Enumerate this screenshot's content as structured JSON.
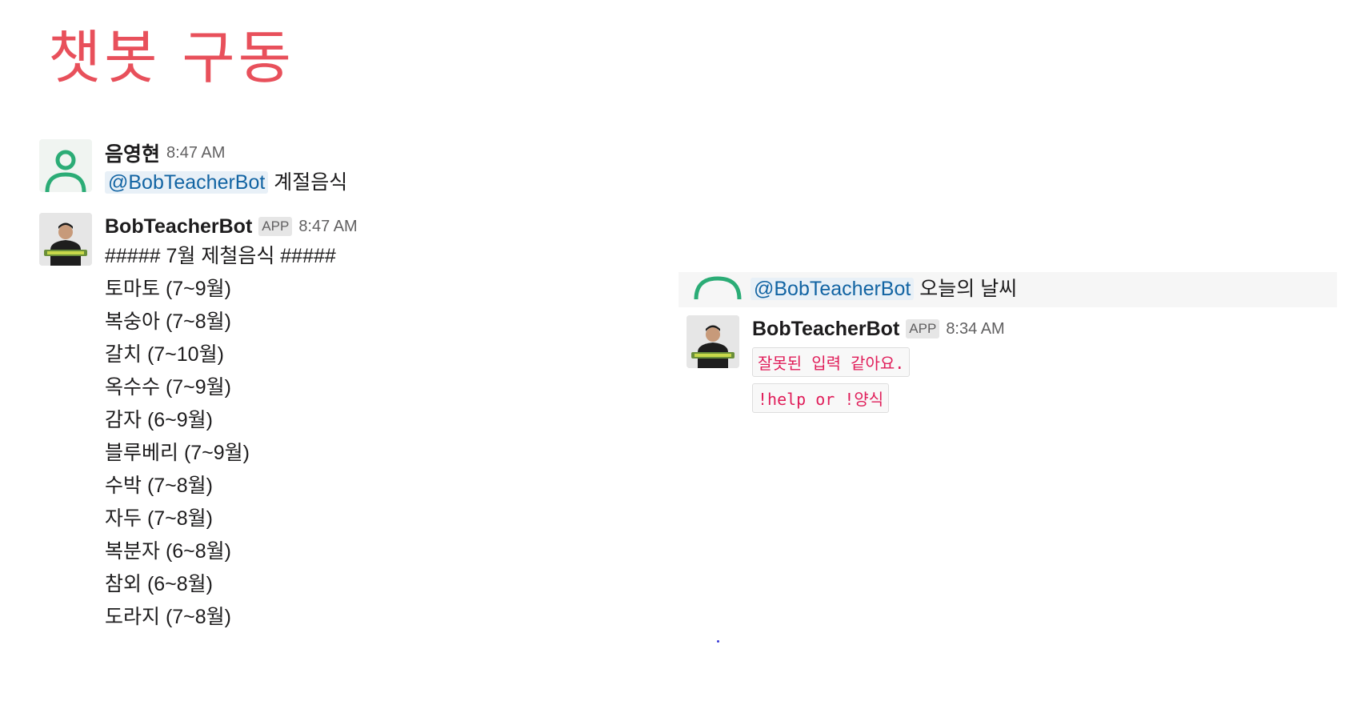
{
  "slide": {
    "title": "챗봇 구동"
  },
  "left_thread": {
    "user_message": {
      "sender": "음영현",
      "time": "8:47 AM",
      "mention": "@BobTeacherBot",
      "text": "계절음식",
      "avatar_icon": "person-outline-icon"
    },
    "bot_message": {
      "sender": "BobTeacherBot",
      "badge": "APP",
      "time": "8:47 AM",
      "avatar_icon": "bot-chef-photo",
      "lines": [
        "##### 7월 제철음식 #####",
        "토마토 (7~9월)",
        "복숭아 (7~8월)",
        "갈치 (7~10월)",
        "옥수수 (7~9월)",
        "감자 (6~9월)",
        "블루베리 (7~9월)",
        "수박 (7~8월)",
        "자두 (7~8월)",
        "복분자 (6~8월)",
        "참외 (6~8월)",
        "도라지 (7~8월)"
      ]
    }
  },
  "right_thread": {
    "user_message": {
      "mention": "@BobTeacherBot",
      "text": "오늘의 날씨"
    },
    "bot_message": {
      "sender": "BobTeacherBot",
      "badge": "APP",
      "time": "8:34 AM",
      "code_lines": [
        "잘못된 입력 같아요.",
        "!help or !양식"
      ]
    }
  },
  "colors": {
    "title": "#e8505b",
    "mention_bg": "#e8f0f7",
    "mention_text": "#1264a3",
    "code_text": "#e01e5a",
    "avatar_green": "#2bac76"
  }
}
